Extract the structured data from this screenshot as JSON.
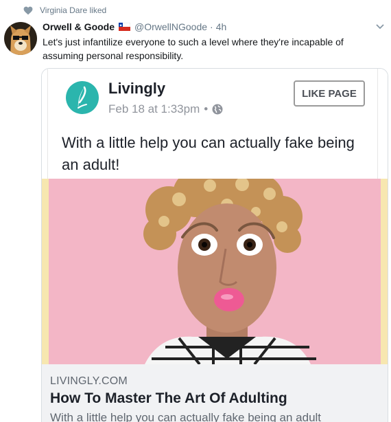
{
  "activity": {
    "text": "Virginia Dare liked",
    "icon": "heart-icon"
  },
  "tweet": {
    "display_name": "Orwell & Goode",
    "flag": "chile-flag-icon",
    "handle": "@OrwellNGoode",
    "separator": "·",
    "time": "4h",
    "text": "Let's just infantilize everyone to such a level where they're incapable of assuming personal responsibility."
  },
  "card": {
    "page_name": "Livingly",
    "post_date": "Feb 18 at 1:33pm",
    "meta_separator": "•",
    "privacy_icon": "globe-icon",
    "like_button": "LIKE PAGE",
    "post_text": "With a little help you can actually fake being an adult!",
    "link": {
      "domain": "LIVINGLY.COM",
      "title": "How To Master The Art Of Adulting",
      "description": "With a little help you can actually fake being an adult"
    }
  },
  "colors": {
    "livingly_teal": "#2bb5ad",
    "photo_background": "#f3b6c6",
    "lipstick": "#ee5a94",
    "muted_text": "#657786"
  }
}
